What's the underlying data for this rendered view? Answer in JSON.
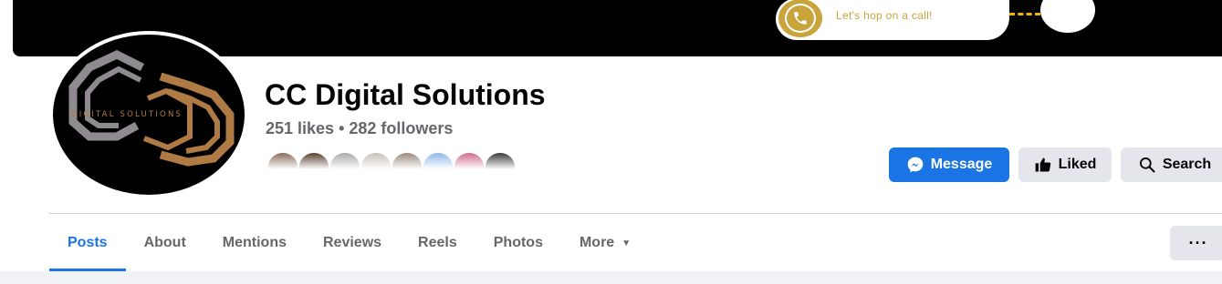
{
  "cover": {
    "call_text": "Let's hop on a call!",
    "accent_color": "#c9a43a"
  },
  "avatar": {
    "logo_text": "DIGITAL SOLUTIONS"
  },
  "page": {
    "name": "CC Digital Solutions",
    "stats": "251 likes • 282 followers"
  },
  "followers_faces": [
    {
      "icon": "follower-avatar"
    },
    {
      "icon": "follower-avatar"
    },
    {
      "icon": "follower-avatar"
    },
    {
      "icon": "follower-avatar"
    },
    {
      "icon": "follower-avatar"
    },
    {
      "icon": "follower-avatar"
    },
    {
      "icon": "follower-avatar"
    },
    {
      "icon": "follower-avatar"
    }
  ],
  "actions": {
    "message_label": "Message",
    "liked_label": "Liked",
    "search_label": "Search",
    "brand_color": "#1b74e4"
  },
  "tabs": [
    {
      "label": "Posts",
      "active": true
    },
    {
      "label": "About"
    },
    {
      "label": "Mentions"
    },
    {
      "label": "Reviews"
    },
    {
      "label": "Reels"
    },
    {
      "label": "Photos"
    },
    {
      "label": "More"
    }
  ],
  "more_button": "···"
}
